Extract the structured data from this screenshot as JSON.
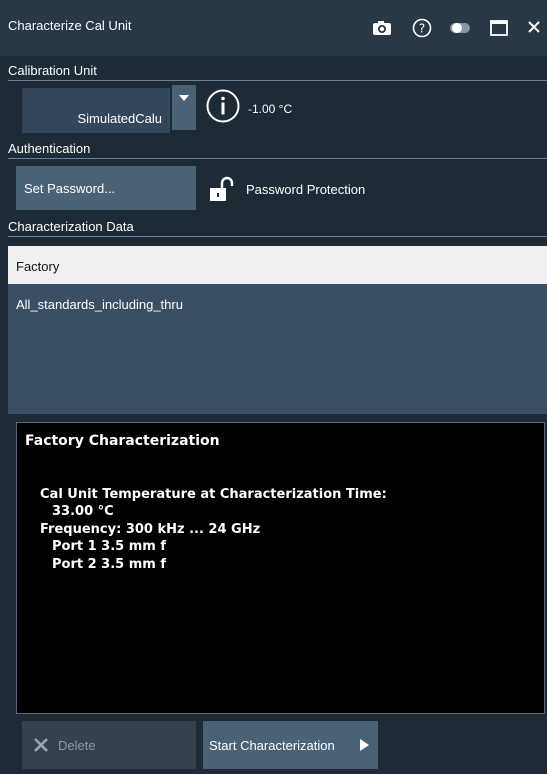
{
  "window": {
    "title": "Characterize Cal Unit",
    "icons": [
      "camera-icon",
      "help-icon",
      "toggle-icon",
      "maximize-icon",
      "close-icon"
    ]
  },
  "calibration_unit": {
    "section_label": "Calibration Unit",
    "selected_unit": "SimulatedCalu",
    "temperature": "-1.00 °C"
  },
  "authentication": {
    "section_label": "Authentication",
    "set_password_label": "Set Password...",
    "protection_label": "Password Protection"
  },
  "characterization_data": {
    "section_label": "Characterization Data",
    "items": [
      "Factory",
      "All_standards_including_thru"
    ],
    "selected_index": 0
  },
  "info": {
    "heading": "Factory Characterization",
    "lines": [
      "Cal Unit Temperature at Characterization Time:",
      "33.00 °C",
      "Frequency: 300 kHz ... 24 GHz",
      "Port 1 3.5 mm f",
      "Port 2 3.5 mm f"
    ]
  },
  "actions": {
    "delete_label": "Delete",
    "start_label": "Start Characterization"
  },
  "colors": {
    "window_bg": "#1e2a36",
    "titlebar_bg": "#2a3744",
    "button_bg": "#4b6275",
    "selected_row_bg": "#f0f0f0"
  }
}
